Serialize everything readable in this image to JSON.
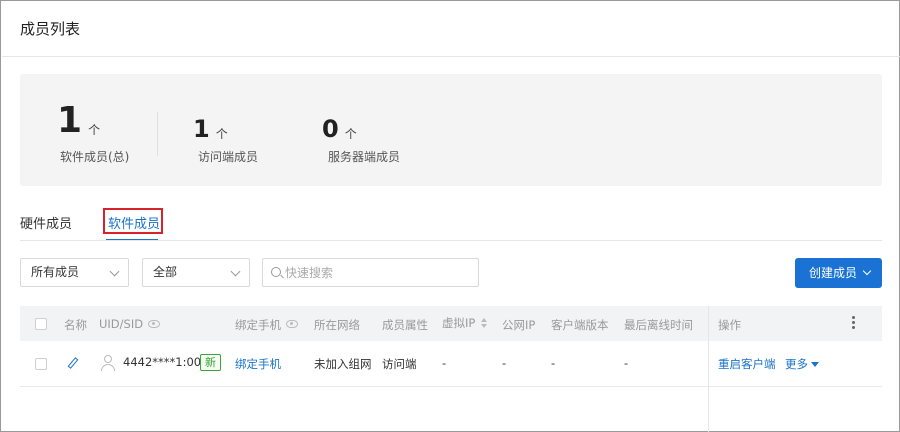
{
  "page": {
    "title": "成员列表"
  },
  "stats": [
    {
      "value": "1",
      "unit": "个",
      "label": "软件成员(总)"
    },
    {
      "value": "1",
      "unit": "个",
      "label": "访问端成员"
    },
    {
      "value": "0",
      "unit": "个",
      "label": "服务器端成员"
    }
  ],
  "tabs": [
    {
      "label": "硬件成员",
      "active": false
    },
    {
      "label": "软件成员",
      "active": true
    }
  ],
  "filters": {
    "member_scope": "所有成员",
    "status": "全部",
    "search_placeholder": "快速搜索"
  },
  "actions": {
    "create_label": "创建成员"
  },
  "table": {
    "columns": [
      "名称",
      "UID/SID",
      "绑定手机",
      "所在网络",
      "成员属性",
      "虚拟IP",
      "公网IP",
      "客户端版本",
      "最后离线时间",
      "操作"
    ],
    "rows": [
      {
        "uid": "4442****1:001",
        "badge": "新",
        "phone": "绑定手机",
        "network": "未加入组网",
        "attribute": "访问端",
        "virtual_ip": "-",
        "public_ip": "-",
        "client_version": "-",
        "last_offline": "-",
        "action_primary": "重启客户端",
        "action_more": "更多"
      }
    ]
  },
  "colors": {
    "accent": "#1a73d4",
    "highlight": "#d9222a",
    "badge": "#3aa53a"
  }
}
